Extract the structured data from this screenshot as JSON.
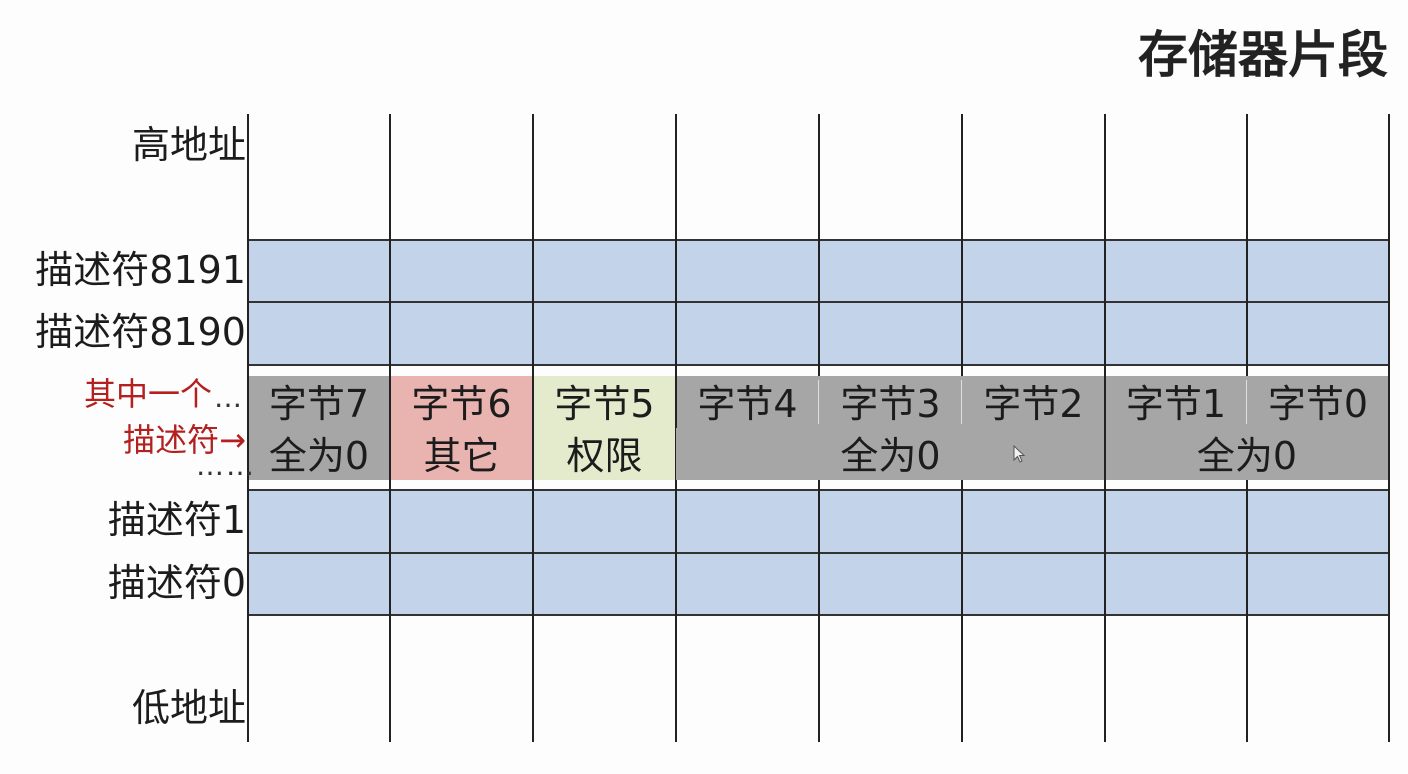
{
  "title": "存储器片段",
  "labels": {
    "high_address": "高地址",
    "desc_8191": "描述符8191",
    "desc_8190": "描述符8190",
    "one_of": "其中一个",
    "descriptor_arrow": "描述符→",
    "desc_1": "描述符1",
    "desc_0": "描述符0",
    "low_address": "低地址"
  },
  "bytes": [
    "字节7",
    "字节6",
    "字节5",
    "字节4",
    "字节3",
    "字节2",
    "字节1",
    "字节0"
  ],
  "contents": {
    "byte7": "全为0",
    "byte6": "其它",
    "byte5": "权限",
    "bytes4_2": "全为0",
    "bytes1_0": "全为0"
  },
  "colors": {
    "descriptor_row": "#c3d3e9",
    "expanded_row": "#a6a6a6",
    "byte6_highlight": "#e9b4b0",
    "byte5_highlight": "#e3ebcc",
    "callout_text": "#b41f1f"
  }
}
